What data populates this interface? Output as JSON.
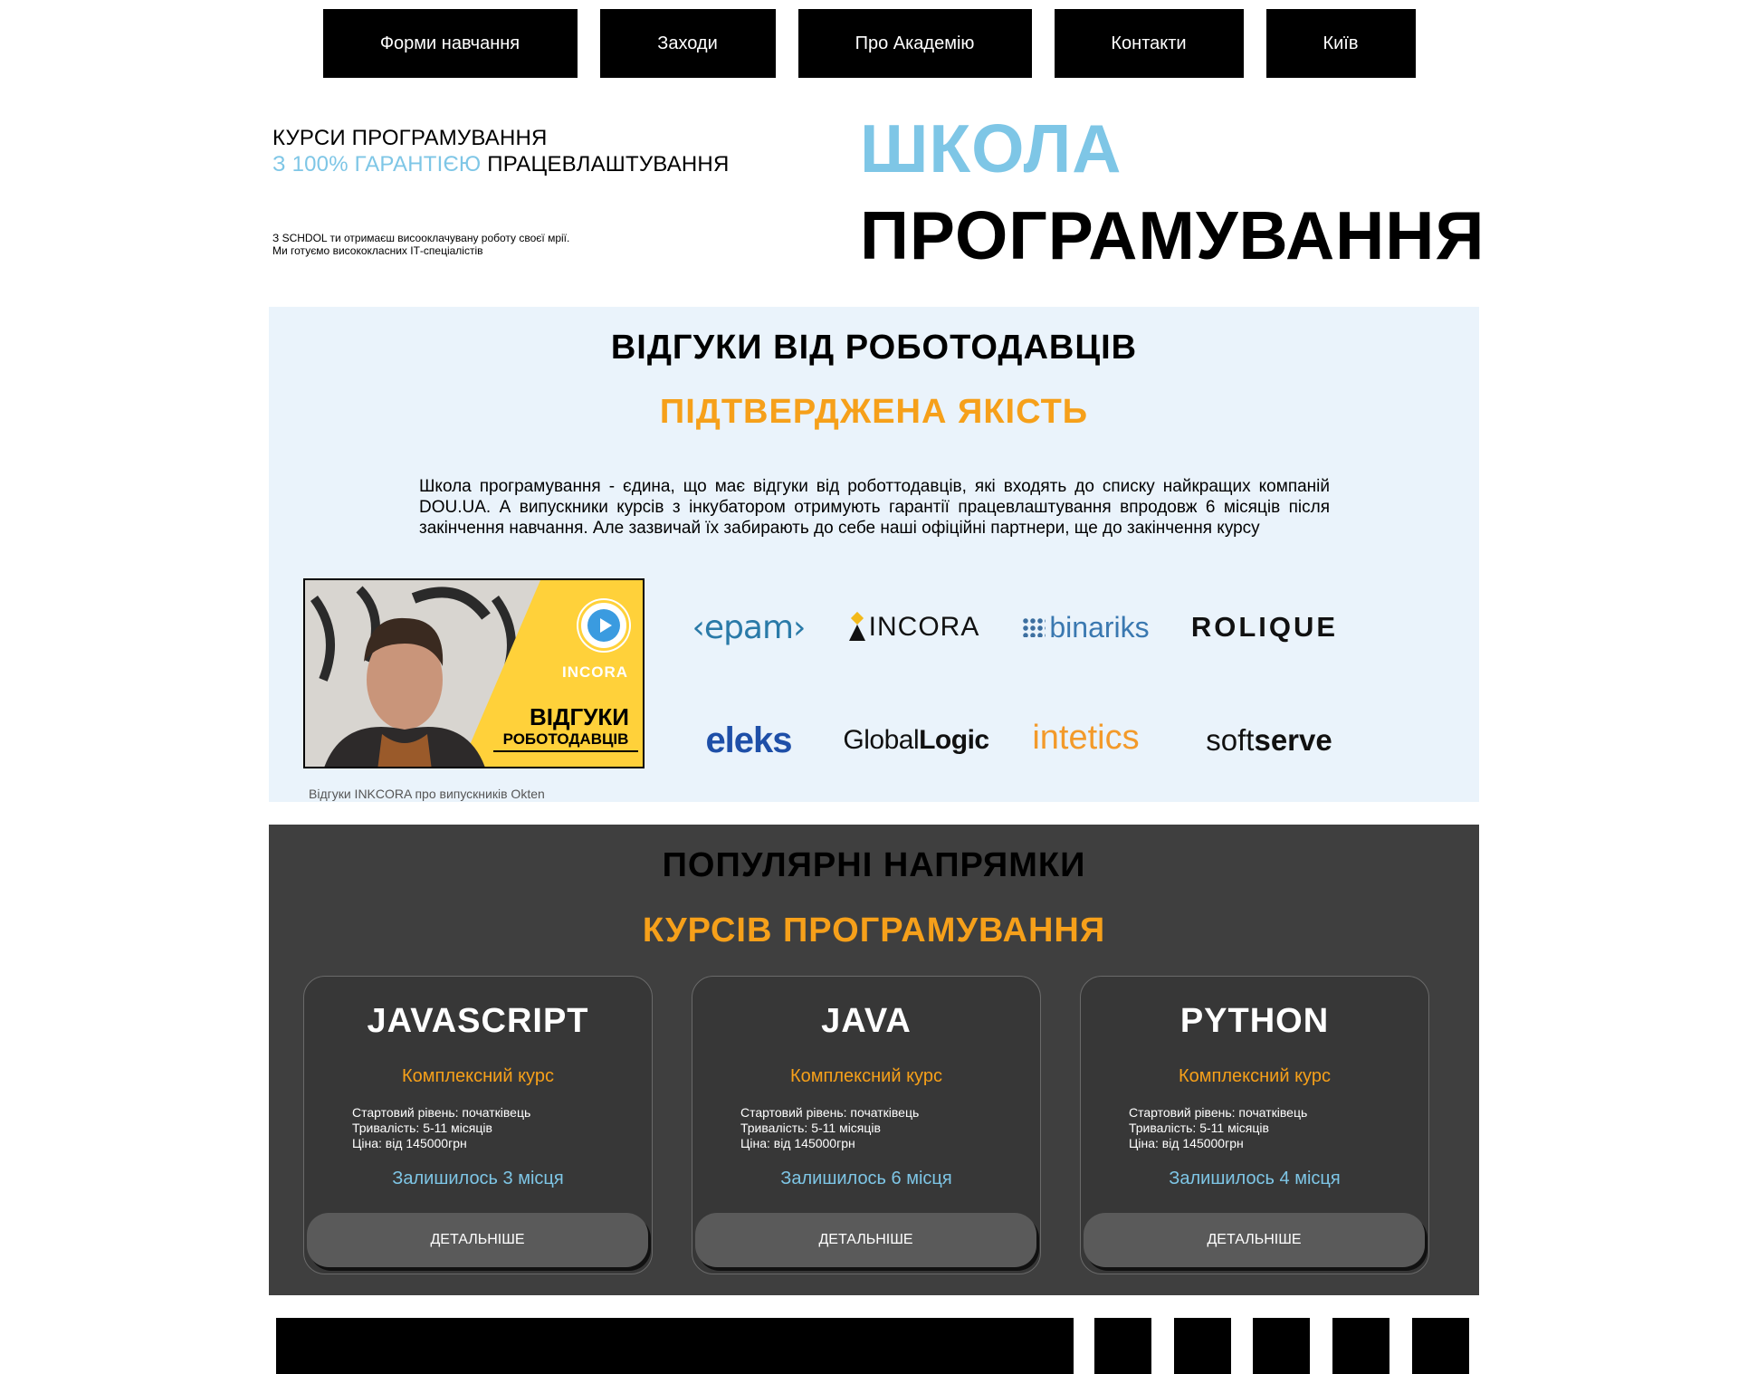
{
  "nav": {
    "items": [
      "Форми навчання",
      "Заходи",
      "Про Академію",
      "Контакти",
      "Київ"
    ]
  },
  "hero": {
    "line1": "КУРСИ ПРОГРАМУВАННЯ",
    "line2_accent": "З 100% ГАРАНТІЄЮ",
    "line2_rest": " ПРАЦЕВЛАШТУВАННЯ",
    "small1": "З SCHDOL ти отримаєш висооклачувану роботу своєї мрії.",
    "small2": "Ми готуємо висококласних ІТ-спеціалістів",
    "title1": "ШКОЛА",
    "title2": "ПРОГРАМУВАННЯ"
  },
  "reviews": {
    "title": "ВІДГУКИ ВІД РОБОТОДАВЦІВ",
    "subtitle": "ПІДТВЕРДЖЕНА ЯКІСТЬ",
    "text": "Школа програмування - єдина, що має відгуки від роботтодавців, які входять до списку найкращих компаній DOU.UA. А випускники курсів з інкубатором отримують гарантії працевлаштування впродовж 6 місяців після закінчення навчання. Але зазвичай їх забирають до себе наші офіційні партнери, ще до закінчення курсу",
    "video": {
      "brand": "INCORA",
      "line1": "ВІДГУКИ",
      "line2": "РОБОТОДАВЦІВ",
      "caption": "Відгуки INKCORA про випускників Okten"
    },
    "logos": [
      "‹epam›",
      "INCORA",
      "binariks",
      "ROLIQUE",
      "eleks",
      "GlobalLogic",
      "intetics",
      "softserve"
    ]
  },
  "courses": {
    "title": "ПОПУЛЯРНІ НАПРЯМКИ",
    "subtitle": "КУРСІВ ПРОГРАМУВАННЯ",
    "cards": [
      {
        "name": "JAVASCRIPT",
        "type": "Комплексний курс",
        "level": "Стартовий рівень: початківець",
        "duration": "Тривалість: 5-11 місяців",
        "price": "Ціна: від 145000грн",
        "seats": "Залишилось 3 місця",
        "button": "ДЕТАЛЬНІШЕ"
      },
      {
        "name": "JAVA",
        "type": "Комплексний курс",
        "level": "Стартовий рівень: початківець",
        "duration": "Тривалість: 5-11 місяців",
        "price": "Ціна: від 145000грн",
        "seats": "Залишилось 6 місця",
        "button": "ДЕТАЛЬНІШЕ"
      },
      {
        "name": "PYTHON",
        "type": "Комплексний курс",
        "level": "Стартовий рівень: початківець",
        "duration": "Тривалість: 5-11 місяців",
        "price": "Ціна: від 145000грн",
        "seats": "Залишилось 4 місця",
        "button": "ДЕТАЛЬНІШЕ"
      }
    ]
  },
  "colors": {
    "accent_blue": "#7ec6e6",
    "accent_orange": "#f6a01a",
    "reviews_bg": "#eaf3fb",
    "courses_bg": "#3f3f3f"
  },
  "icons": [
    "play-icon"
  ]
}
